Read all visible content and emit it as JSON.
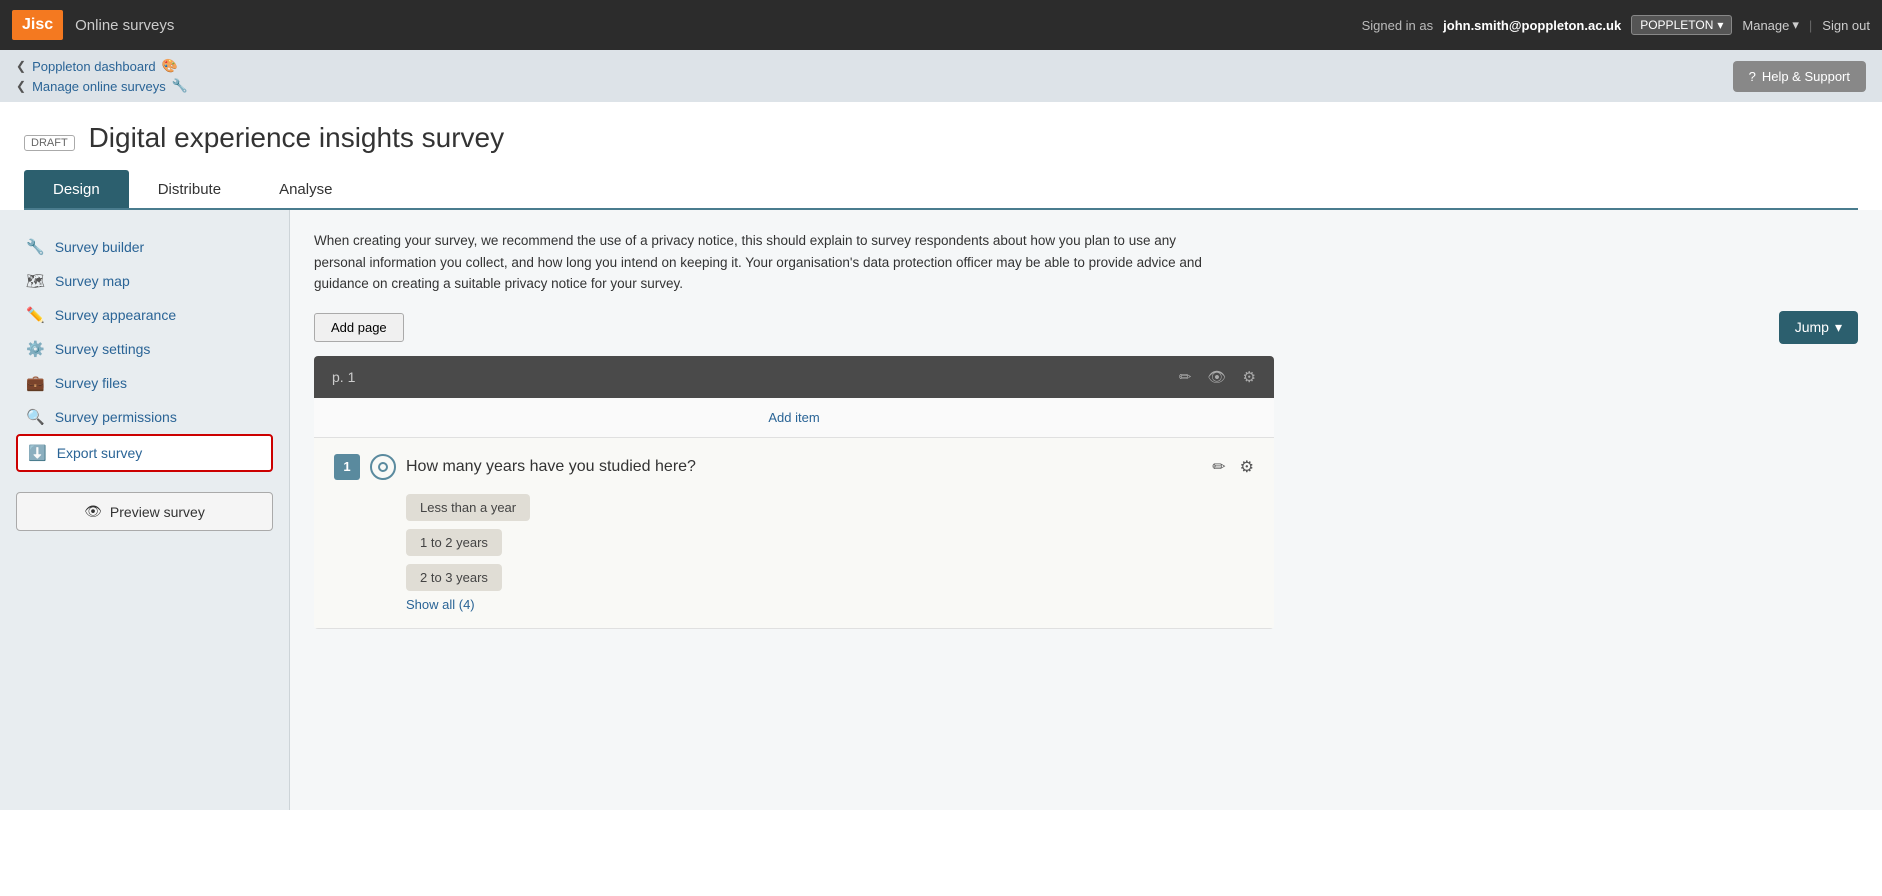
{
  "topnav": {
    "logo": "Jisc",
    "title": "Online surveys",
    "signed_in_label": "Signed in as",
    "email": "john.smith@poppleton.ac.uk",
    "org": "POPPLETON",
    "manage": "Manage",
    "signout": "Sign out"
  },
  "breadcrumbs": {
    "item1": "Poppleton dashboard",
    "item2": "Manage online surveys",
    "help_btn": "Help & Support"
  },
  "page_title_area": {
    "draft_badge": "DRAFT",
    "title": "Digital experience insights survey"
  },
  "tabs": [
    {
      "label": "Design",
      "active": true
    },
    {
      "label": "Distribute",
      "active": false
    },
    {
      "label": "Analyse",
      "active": false
    }
  ],
  "sidebar": {
    "items": [
      {
        "label": "Survey builder",
        "icon": "wrench"
      },
      {
        "label": "Survey map",
        "icon": "map"
      },
      {
        "label": "Survey appearance",
        "icon": "pencil"
      },
      {
        "label": "Survey settings",
        "icon": "gear"
      },
      {
        "label": "Survey files",
        "icon": "briefcase"
      },
      {
        "label": "Survey permissions",
        "icon": "search"
      },
      {
        "label": "Export survey",
        "icon": "download",
        "highlighted": true
      }
    ],
    "preview_btn": "Preview survey"
  },
  "content": {
    "privacy_notice": "When creating your survey, we recommend the use of a privacy notice, this should explain to survey respondents about how you plan to use any personal information you collect, and how long you intend on keeping it. Your organisation's data protection officer may be able to provide advice and guidance on creating a suitable privacy notice for your survey.",
    "add_page_btn": "Add page",
    "jump_btn": "Jump",
    "page_num": "p. 1",
    "add_item": "Add item",
    "question": {
      "num": "1",
      "text": "How many years have you studied here?",
      "answers": [
        "Less than a year",
        "1 to 2 years",
        "2 to 3 years"
      ],
      "show_all": "Show all (4)"
    }
  },
  "icons": {
    "chevron_left": "❮",
    "chevron_down": "▾",
    "question_mark": "?",
    "eye": "👁",
    "pencil": "✏",
    "gear": "⚙",
    "eye_small": "👁"
  }
}
